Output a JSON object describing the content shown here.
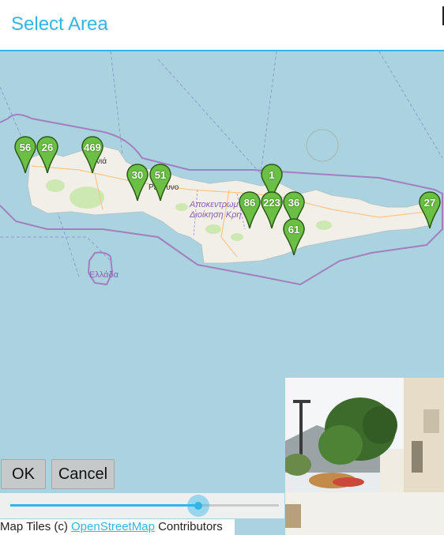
{
  "dialog": {
    "title": "Select Area"
  },
  "map": {
    "region_label_line1": "Αποκεντρωμ",
    "region_label_line2": "Διοίκηση Κρη",
    "country_label": "Ελλάδα",
    "city_label_1": "νιά",
    "city_label_2": "Ρε    υνο"
  },
  "markers": [
    {
      "count": "56"
    },
    {
      "count": "26"
    },
    {
      "count": "469"
    },
    {
      "count": "30"
    },
    {
      "count": "51"
    },
    {
      "count": "1"
    },
    {
      "count": "86"
    },
    {
      "count": "223"
    },
    {
      "count": "36"
    },
    {
      "count": "61"
    },
    {
      "count": "27"
    }
  ],
  "buttons": {
    "ok": "OK",
    "cancel": "Cancel"
  },
  "slider": {
    "value_fraction": 0.7
  },
  "attribution": {
    "prefix": "Map Tiles (c) ",
    "link": "OpenStreetMap",
    "suffix": " Contributors"
  },
  "colors": {
    "accent": "#33b5e5",
    "marker_green": "#6abf44",
    "sea": "#aad3df",
    "land": "#f2efe9"
  }
}
